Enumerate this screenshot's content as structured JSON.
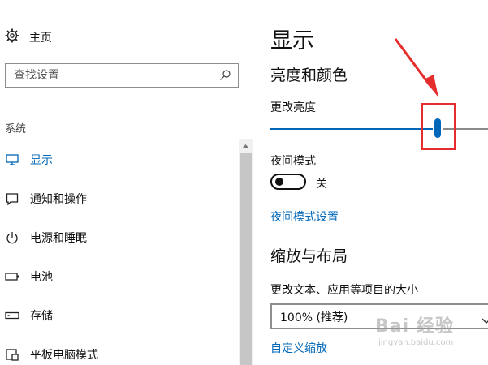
{
  "sidebar": {
    "home_label": "主页",
    "search_placeholder": "查找设置",
    "group_label": "系统",
    "items": [
      {
        "label": "显示",
        "icon": "monitor-icon",
        "active": true
      },
      {
        "label": "通知和操作",
        "icon": "notification-icon",
        "active": false
      },
      {
        "label": "电源和睡眠",
        "icon": "power-icon",
        "active": false
      },
      {
        "label": "电池",
        "icon": "battery-icon",
        "active": false
      },
      {
        "label": "存储",
        "icon": "storage-icon",
        "active": false
      },
      {
        "label": "平板电脑模式",
        "icon": "tablet-icon",
        "active": false
      }
    ]
  },
  "main": {
    "title": "显示",
    "brightness_section": "亮度和颜色",
    "brightness_label": "更改亮度",
    "brightness_value": 0.77,
    "night_mode_label": "夜间模式",
    "night_mode_state": "关",
    "night_mode_settings_link": "夜间模式设置",
    "scale_section": "缩放与布局",
    "scale_label": "更改文本、应用等项目的大小",
    "scale_selected": "100% (推荐)",
    "custom_scale_link": "自定义缩放"
  },
  "watermark": {
    "main": "Bai 经验",
    "sub": "jingyan.baidu.com"
  },
  "colors": {
    "accent": "#0067b8",
    "annotation": "#e52d2d"
  }
}
